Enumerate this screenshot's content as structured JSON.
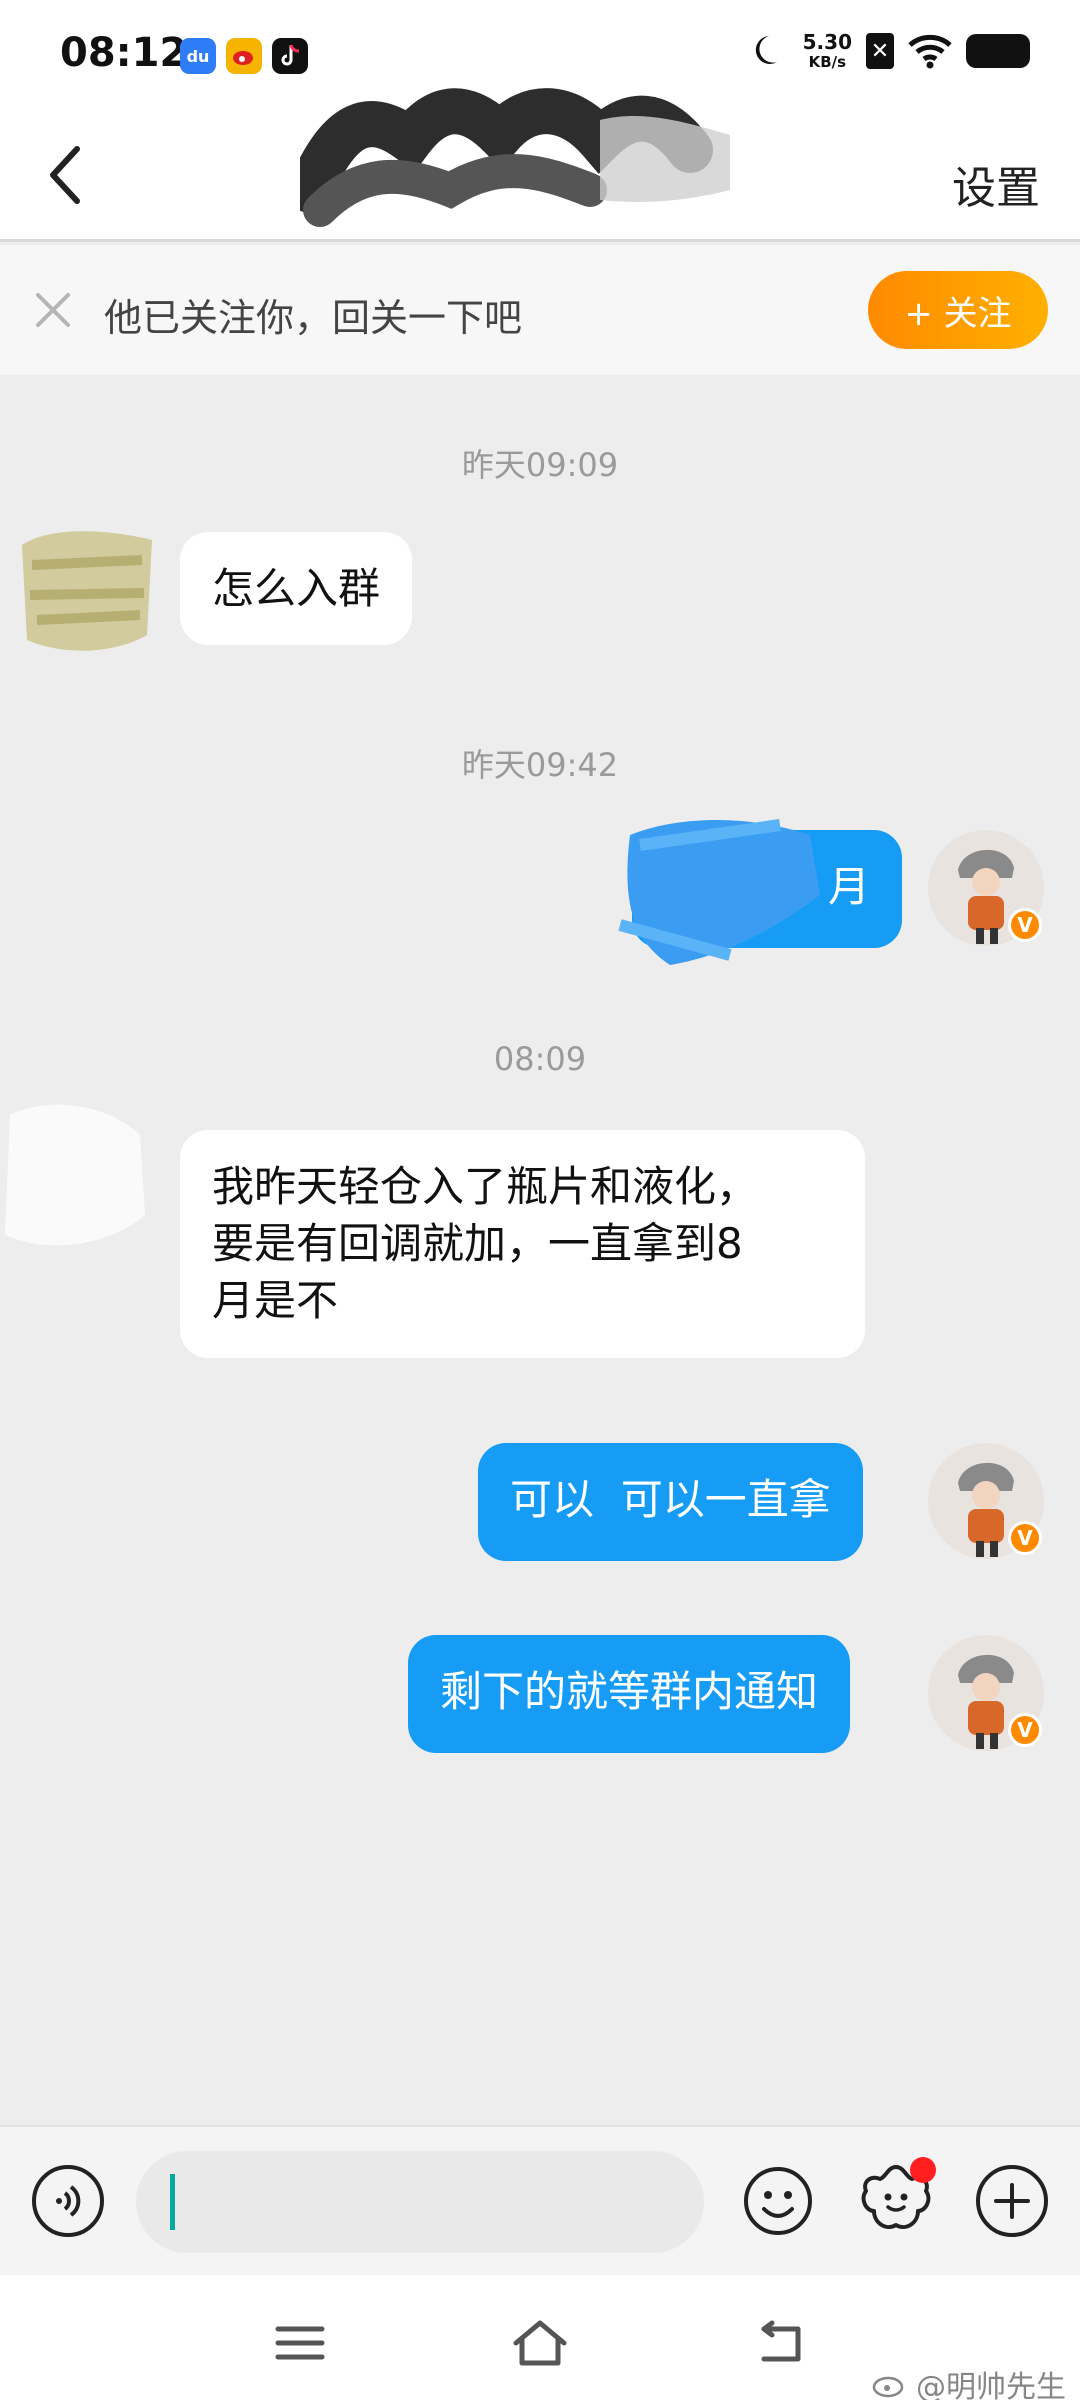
{
  "status_bar": {
    "time": "08:12",
    "net_speed_value": "5.30",
    "net_speed_unit": "KB/s",
    "apps": [
      "baidu-app-icon",
      "weibo-app-icon",
      "tiktok-app-icon"
    ],
    "icons": [
      "moon-icon",
      "sim-off-icon",
      "wifi-icon",
      "battery-icon"
    ]
  },
  "header": {
    "settings_label": "设置",
    "title": ""
  },
  "follow_banner": {
    "text": "他已关注你，回关一下吧",
    "button_label": "+ 关注",
    "accent": "#ff9a00"
  },
  "chat": {
    "timestamps": [
      "昨天09:09",
      "昨天09:42",
      "08:09"
    ],
    "messages": [
      {
        "side": "in",
        "text": "怎么入群"
      },
      {
        "side": "out",
        "text": "月"
      },
      {
        "side": "in",
        "lines": [
          "我昨天轻仓入了瓶片和液化，",
          "要是有回调就加，一直拿到8",
          "月是不"
        ]
      },
      {
        "side": "out",
        "text": "可以  可以一直拿"
      },
      {
        "side": "out",
        "text": "剩下的就等群内通知"
      }
    ],
    "outgoing_color": "#169cf5",
    "incoming_color": "#ffffff"
  },
  "input_bar": {
    "input_value": "",
    "icons": [
      "voice-icon",
      "emoji-icon",
      "sticker-icon",
      "plus-icon"
    ]
  },
  "nav_bar": {
    "icons": [
      "menu-icon",
      "home-icon",
      "back-nav-icon"
    ]
  },
  "watermark": {
    "text": "@明帅先生"
  }
}
